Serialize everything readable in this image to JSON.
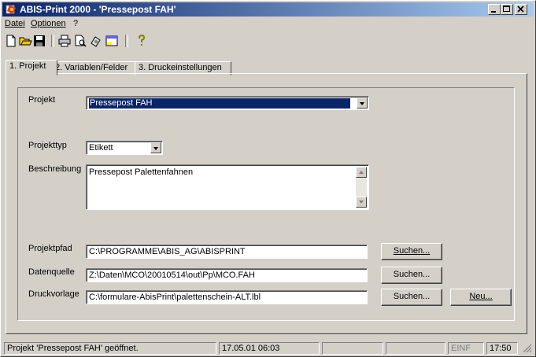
{
  "window": {
    "title": "ABIS-Print 2000 - 'Pressepost FAH'"
  },
  "menu": [
    {
      "label": "Datei"
    },
    {
      "label": "Optionen"
    },
    {
      "label": "?"
    }
  ],
  "toolbar": {
    "icons": [
      "new-file-icon",
      "open-folder-icon",
      "save-icon",
      "print-icon",
      "preview-icon",
      "settings-icon",
      "window-icon",
      "help-icon"
    ]
  },
  "tabs": [
    {
      "label": "1. Projekt"
    },
    {
      "label": "2. Variablen/Felder"
    },
    {
      "label": "3. Druckeinstellungen"
    }
  ],
  "form": {
    "projekt_label": "Projekt",
    "projekt_value": "Pressepost FAH",
    "projekttyp_label": "Projekttyp",
    "projekttyp_value": "Etikett",
    "beschreibung_label": "Beschreibung",
    "beschreibung_value": "Pressepost Palettenfahnen",
    "projektpfad_label": "Projektpfad",
    "projektpfad_value": "C:\\PROGRAMME\\ABIS_AG\\ABISPRINT",
    "datenquelle_label": "Datenquelle",
    "datenquelle_value": "Z:\\Daten\\MCO\\20010514\\out\\Pp\\MCO.FAH",
    "druckvorlage_label": "Druckvorlage",
    "druckvorlage_value": "C:\\formulare-AbisPrint\\palettenschein-ALT.lbl",
    "suchen_label": "Suchen...",
    "neu_label": "Neu..."
  },
  "status": {
    "message": "Projekt 'Pressepost FAH' geöffnet.",
    "datetime": "17.05.01 06:03",
    "einf": "EINF",
    "time": "17:50"
  },
  "colors": {
    "titlebar_start": "#0a246a",
    "titlebar_end": "#a6caf0",
    "selection": "#0a246a",
    "face": "#d4d0c8"
  }
}
